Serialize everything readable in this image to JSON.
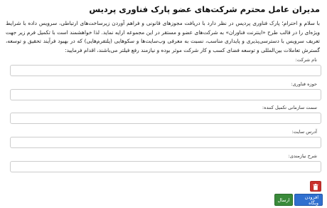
{
  "form": {
    "title": "مدیران عامل محترم شرکت‌های عضو پارک فناوری پردیس",
    "intro": "با سلام و احترام؛ پارک فناوری پردیس در نظر دارد با دریافت مجوزهای قانونی و فراهم آوردن زیرساخت‌های ارتباطی، سرویس داده با شرایط ویژه‌ای را در قالب طرح «اینترنت فناوران» به شرکت‌های عضو و مستقر در این مجموعه ارایه نماید. لذا خواهشمند است با تکمیل فرم زیر جهت تعریف سرویس با دسترسی‌پذیری و پایداری مناسب، نسبت به معرفی وب‌سایت‌ها و سکوهایی (پلتفرم‌هایی) که در بهبود فرآیند تحقیق و توسعه، گسترش تعاملات بین‌المللی و توسعه فضای کسب و کار شرکت موثر بوده و نیازمند رفع فیلتر می‌باشند، اقدام فرمایید:",
    "fields": [
      {
        "label": "نام شرکت:",
        "value": "",
        "placeholder": ""
      },
      {
        "label": "حوزه فناوری:",
        "value": "",
        "placeholder": ""
      },
      {
        "label": "سمت سازمانی تکمیل کننده:",
        "value": "",
        "placeholder": ""
      },
      {
        "label": "آدرس سایت:",
        "value": "",
        "placeholder": ""
      },
      {
        "label": "شرح نیازمندی:",
        "value": "",
        "placeholder": ""
      }
    ],
    "buttons": {
      "send": "ارسال",
      "add_site": "افزودن وبگاه"
    },
    "icons": {
      "delete": "trash-icon"
    },
    "colors": {
      "delete": "#c9302c",
      "send": "#3a8a3a",
      "add_site": "#2f6fcf"
    }
  }
}
